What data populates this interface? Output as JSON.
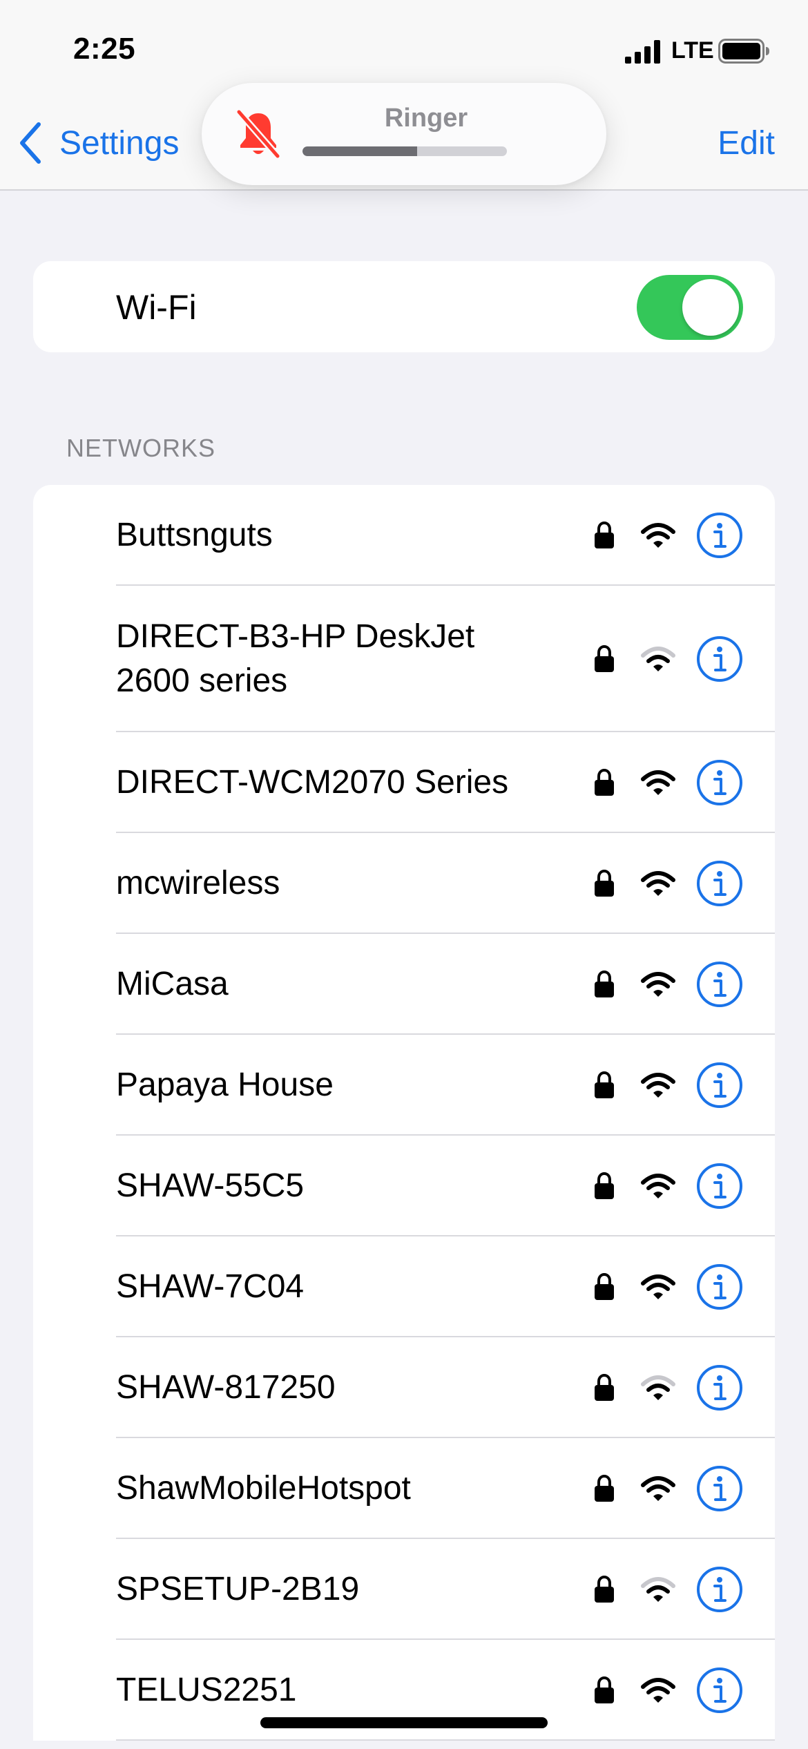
{
  "status_bar": {
    "time": "2:25",
    "network_type": "LTE",
    "signal_icon": "cellular-signal-icon",
    "battery_icon": "battery-icon"
  },
  "nav": {
    "back_label": "Settings",
    "edit_label": "Edit"
  },
  "ringer": {
    "label": "Ringer",
    "icon": "bell-slash-icon",
    "level_fraction": 0.56,
    "icon_color": "#ff3b30"
  },
  "wifi": {
    "label": "Wi-Fi",
    "enabled": true,
    "toggle_color": "#34c759"
  },
  "networks": {
    "section_title": "NETWORKS",
    "items": [
      {
        "name": "Buttsnguts",
        "locked": true,
        "signal": "full"
      },
      {
        "name": "DIRECT-B3-HP DeskJet 2600 series",
        "locked": true,
        "signal": "weak"
      },
      {
        "name": "DIRECT-WCM2070 Series",
        "locked": true,
        "signal": "full"
      },
      {
        "name": "mcwireless",
        "locked": true,
        "signal": "full"
      },
      {
        "name": "MiCasa",
        "locked": true,
        "signal": "full"
      },
      {
        "name": "Papaya House",
        "locked": true,
        "signal": "full"
      },
      {
        "name": "SHAW-55C5",
        "locked": true,
        "signal": "full"
      },
      {
        "name": "SHAW-7C04",
        "locked": true,
        "signal": "full"
      },
      {
        "name": "SHAW-817250",
        "locked": true,
        "signal": "weak"
      },
      {
        "name": "ShawMobileHotspot",
        "locked": true,
        "signal": "full"
      },
      {
        "name": "SPSETUP-2B19",
        "locked": true,
        "signal": "weak"
      },
      {
        "name": "TELUS2251",
        "locked": true,
        "signal": "full"
      }
    ]
  },
  "colors": {
    "accent": "#1a73e8",
    "background": "#f2f2f7"
  }
}
